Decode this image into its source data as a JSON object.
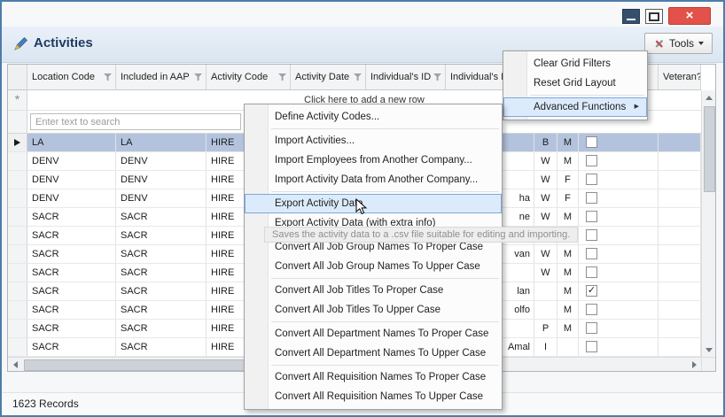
{
  "header": {
    "title": "Activities",
    "tools_label": "Tools"
  },
  "icons": {
    "close_glyph": "×",
    "new_row_glyph": "*",
    "check_glyph": "✓",
    "submenu_arrow_glyph": "▶"
  },
  "grid": {
    "headers": [
      "Location Code",
      "Included in AAP",
      "Activity Code",
      "Activity Date",
      "Individual's ID",
      "Individual's Name",
      "",
      "",
      "",
      "Veteran?"
    ],
    "new_row_text": "Click here to add a new row",
    "search_placeholder": "Enter text to search",
    "rows": [
      {
        "location": "LA",
        "included_in_aap": "LA",
        "activity_code": "HIRE",
        "name_fragment": "",
        "race": "B",
        "gender": "M",
        "veteran_checked": false,
        "selected": true
      },
      {
        "location": "DENV",
        "included_in_aap": "DENV",
        "activity_code": "HIRE",
        "name_fragment": "",
        "race": "W",
        "gender": "M",
        "veteran_checked": false,
        "selected": false
      },
      {
        "location": "DENV",
        "included_in_aap": "DENV",
        "activity_code": "HIRE",
        "name_fragment": "",
        "race": "W",
        "gender": "F",
        "veteran_checked": false,
        "selected": false
      },
      {
        "location": "DENV",
        "included_in_aap": "DENV",
        "activity_code": "HIRE",
        "name_fragment": "ha",
        "race": "W",
        "gender": "F",
        "veteran_checked": false,
        "selected": false
      },
      {
        "location": "SACR",
        "included_in_aap": "SACR",
        "activity_code": "HIRE",
        "name_fragment": "ne",
        "race": "W",
        "gender": "M",
        "veteran_checked": false,
        "selected": false
      },
      {
        "location": "SACR",
        "included_in_aap": "SACR",
        "activity_code": "HIRE",
        "name_fragment": "",
        "race": "",
        "gender": "",
        "veteran_checked": false,
        "selected": false
      },
      {
        "location": "SACR",
        "included_in_aap": "SACR",
        "activity_code": "HIRE",
        "name_fragment": "van",
        "race": "W",
        "gender": "M",
        "veteran_checked": false,
        "selected": false
      },
      {
        "location": "SACR",
        "included_in_aap": "SACR",
        "activity_code": "HIRE",
        "name_fragment": "",
        "race": "W",
        "gender": "M",
        "veteran_checked": false,
        "selected": false
      },
      {
        "location": "SACR",
        "included_in_aap": "SACR",
        "activity_code": "HIRE",
        "name_fragment": "lan",
        "race": "",
        "gender": "M",
        "veteran_checked": true,
        "selected": false
      },
      {
        "location": "SACR",
        "included_in_aap": "SACR",
        "activity_code": "HIRE",
        "name_fragment": "olfo",
        "race": "",
        "gender": "M",
        "veteran_checked": false,
        "selected": false
      },
      {
        "location": "SACR",
        "included_in_aap": "SACR",
        "activity_code": "HIRE",
        "name_fragment": "",
        "race": "P",
        "gender": "M",
        "veteran_checked": false,
        "selected": false
      },
      {
        "location": "SACR",
        "included_in_aap": "SACR",
        "activity_code": "HIRE",
        "name_fragment": "Amal",
        "race": "I",
        "gender": "",
        "veteran_checked": false,
        "selected": false
      }
    ]
  },
  "tools_menu": {
    "items": [
      {
        "label": "Clear Grid Filters",
        "has_submenu": false,
        "highlighted": false
      },
      {
        "label": "Reset Grid Layout",
        "has_submenu": false,
        "highlighted": false
      },
      {
        "label": "Advanced Functions",
        "has_submenu": true,
        "highlighted": true
      }
    ],
    "separators_after": [
      1
    ]
  },
  "advanced_menu": {
    "items": [
      "Define Activity Codes...",
      "Import Activities...",
      "Import Employees from Another Company...",
      "Import Activity Data from Another Company...",
      "Export Activity Data",
      "Export Activity Data (with extra info)",
      "Convert All Job Group Names To Proper Case",
      "Convert All Job Group Names To Upper Case",
      "Convert All Job Titles To Proper Case",
      "Convert All Job Titles To Upper Case",
      "Convert All Department Names To Proper Case",
      "Convert All Department Names To Upper Case",
      "Convert All Requisition Names To Proper Case",
      "Convert All Requisition Names To Upper Case"
    ],
    "highlighted_index": 4,
    "separators_after": [
      0,
      3,
      5,
      7,
      9,
      11
    ]
  },
  "tooltip": "Saves the activity data to a .csv file suitable for editing and importing.",
  "status": {
    "records": "1623 Records"
  }
}
